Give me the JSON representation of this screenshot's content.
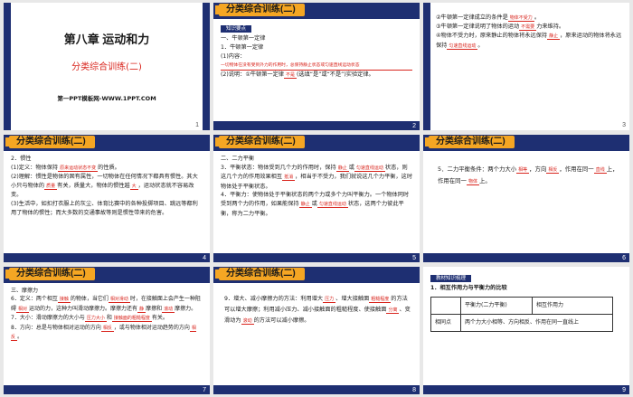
{
  "header_title": "分类综合训练(二)",
  "slides": [
    {
      "num": "1",
      "chapter": "第八章  运动和力",
      "subtitle": "分类综合训练(二)",
      "site": "第一PPT模板网-WWW.1PPT.COM"
    },
    {
      "num": "2",
      "tag": "知识要点",
      "lines": [
        "一、牛顿第一定律",
        "1．牛顿第一定律",
        "(1)内容：",
        "一切物体在没有受到外力的作用时，总保持静止状态或匀速直线运动状态",
        "(2)说明：①牛顿第一定律",
        "(选填“是”或“不是”)实验定律。"
      ],
      "blank1": "不是"
    },
    {
      "num": "3",
      "lines": [
        "②牛顿第一定律成立的条件是",
        "③牛顿第一定律说明了物体的运动",
        "力来维持。",
        "④物体不受力时，原来静止的物体将永远保持",
        "，原来运动的物体将永远保持",
        "。"
      ],
      "blanks": [
        "物体不受力",
        "不需要",
        "静止",
        "匀速直线运动"
      ]
    },
    {
      "num": "4",
      "lines": [
        "2．惯性",
        "(1)定义：物体保持",
        "的性质。",
        "(2)理解：惯性是物体的固有属性，一切物体在任何情况下都具有惯性。其大小只与物体的",
        "有关，质量大，物体的惯性越",
        "，运动状态就不容易改变。",
        "(3)生活中，如扣打衣服上的灰尘、体育比赛中的各种投掷项目、跳远等都利用了物体的惯性；而大多数的交通事故等则是惯性带来的危害。"
      ],
      "blanks": [
        "原来运动状态不变",
        "质量",
        "大"
      ]
    },
    {
      "num": "5",
      "lines": [
        "二、二力平衡",
        "3．平衡状态：物体受到几个力的作用时，保持",
        "或",
        "状态，则这几个力的作用效果相互",
        "，相当于不受力，我们就说这几个力平衡，这时物体处于平衡状态。",
        "4．平衡力：使物体处于平衡状态的两个力或多个力叫平衡力。一个物体同时受到两个力的作用，如果能保持",
        "或",
        "状态，这两个力彼此平衡，称为二力平衡。"
      ],
      "blanks": [
        "静止",
        "匀速直线运动",
        "抵消",
        "静止",
        "匀速直线运动"
      ]
    },
    {
      "num": "6",
      "lines": [
        "5．二力平衡条件：两个力大小",
        "，方向",
        "，作用在同一",
        "上，作用在同一",
        "上。"
      ],
      "blanks": [
        "相等",
        "相反",
        "直线",
        "物体"
      ]
    },
    {
      "num": "7",
      "lines": [
        "三、摩擦力",
        "6．定义：两个相互",
        "的物体，当它们",
        "时，在接触面上会产生一种阻碍",
        "运动的力，这种力叫滑动摩擦力。摩擦力还有",
        "摩擦和",
        "摩擦力。",
        "7．大小：滑动摩擦力的大小与",
        "和",
        "有关。",
        "8．方向：总是与物体相对运动的方向",
        "，或与物体相对运动趋势的方向",
        "。"
      ],
      "blanks": [
        "接触",
        "相对滑动",
        "相对",
        "静",
        "滚动",
        "压力大小",
        "接触面的粗糙程度",
        "相反",
        "相反"
      ]
    },
    {
      "num": "8",
      "lines": [
        "9．增大、减小摩擦力的方法：利用增大",
        "、增大接触面",
        "的方法可以增大摩擦；利用减小压力、减小接触面的粗糙程度、使接触面",
        "、变滑动为",
        "的方法可以减小摩擦。"
      ],
      "blanks": [
        "压力",
        "粗糙程度",
        "分离",
        "滚动"
      ]
    },
    {
      "num": "9",
      "tag": "教材知识梳理",
      "lines": [
        "1．相互作用力与平衡力的比较"
      ],
      "table": {
        "headers": [
          "",
          "平衡力(二力平衡)",
          "相互作用力"
        ],
        "rows": [
          [
            "相同点",
            "两个力大小相等、方向相反、作用在同一直线上",
            ""
          ]
        ]
      }
    }
  ]
}
